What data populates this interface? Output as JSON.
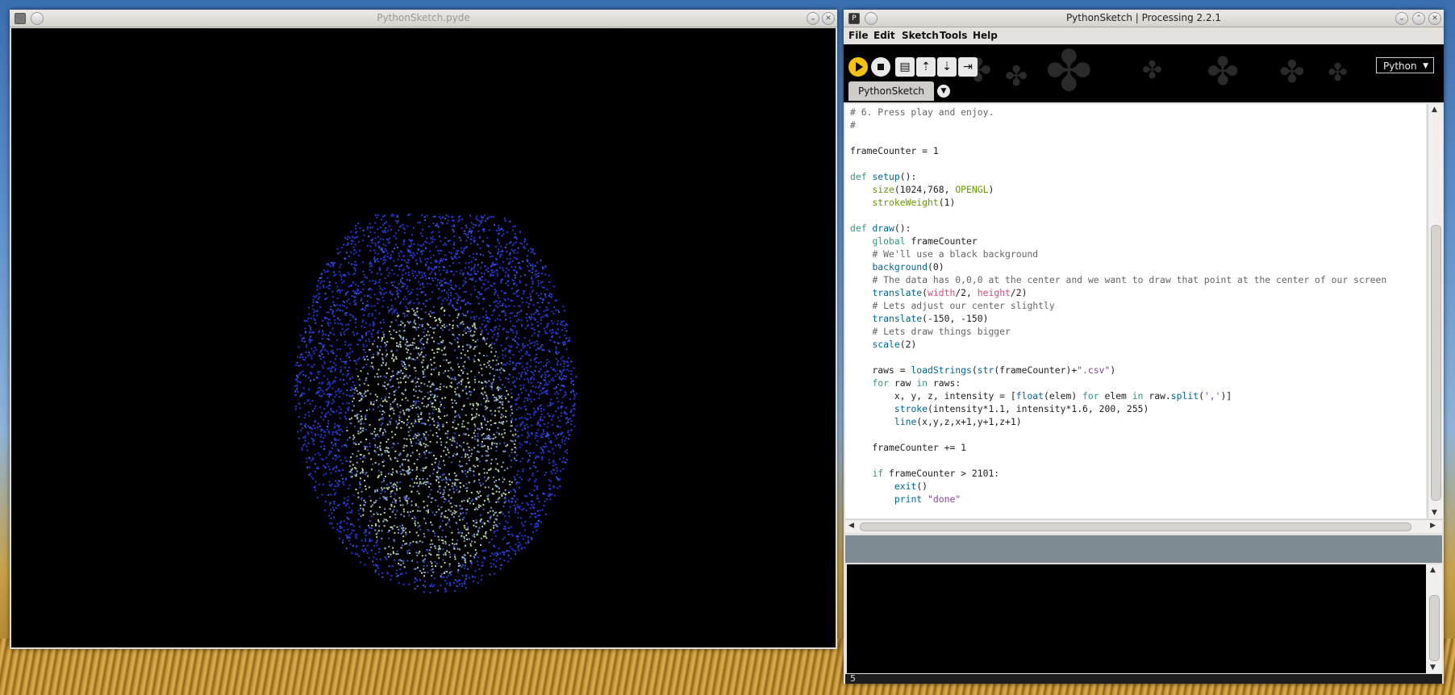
{
  "sketch_window": {
    "title": "PythonSketch.pyde"
  },
  "ide_window": {
    "title": "PythonSketch | Processing 2.2.1"
  },
  "menu": [
    "File",
    "Edit",
    "Sketch",
    "Tools",
    "Help"
  ],
  "toolbar": {
    "mode": "Python"
  },
  "tab": {
    "label": "PythonSketch"
  },
  "code": [
    [
      [
        "cm",
        "# 6. Press play and enjoy."
      ]
    ],
    [
      [
        "cm",
        "#"
      ]
    ],
    [],
    [
      [
        "t",
        "frameCounter = 1"
      ]
    ],
    [],
    [
      [
        "kw",
        "def "
      ],
      [
        "fn",
        "setup"
      ],
      [
        "t",
        "():"
      ]
    ],
    [
      [
        "t",
        "    "
      ],
      [
        "fn2",
        "size"
      ],
      [
        "t",
        "(1024,768, "
      ],
      [
        "fn2",
        "OPENGL"
      ],
      [
        "t",
        ")"
      ]
    ],
    [
      [
        "t",
        "    "
      ],
      [
        "fn2",
        "strokeWeight"
      ],
      [
        "t",
        "(1)"
      ]
    ],
    [],
    [
      [
        "kw",
        "def "
      ],
      [
        "fn",
        "draw"
      ],
      [
        "t",
        "():"
      ]
    ],
    [
      [
        "t",
        "    "
      ],
      [
        "kw",
        "global"
      ],
      [
        "t",
        " frameCounter"
      ]
    ],
    [
      [
        "t",
        "    "
      ],
      [
        "cm",
        "# We'll use a black background"
      ]
    ],
    [
      [
        "t",
        "    "
      ],
      [
        "fn",
        "background"
      ],
      [
        "t",
        "(0)"
      ]
    ],
    [
      [
        "t",
        "    "
      ],
      [
        "cm",
        "# The data has 0,0,0 at the center and we want to draw that point at the center of our screen"
      ]
    ],
    [
      [
        "t",
        "    "
      ],
      [
        "fn",
        "translate"
      ],
      [
        "t",
        "("
      ],
      [
        "var",
        "width"
      ],
      [
        "t",
        "/2, "
      ],
      [
        "var",
        "height"
      ],
      [
        "t",
        "/2)"
      ]
    ],
    [
      [
        "t",
        "    "
      ],
      [
        "cm",
        "# Lets adjust our center slightly"
      ]
    ],
    [
      [
        "t",
        "    "
      ],
      [
        "fn",
        "translate"
      ],
      [
        "t",
        "(-150, -150)"
      ]
    ],
    [
      [
        "t",
        "    "
      ],
      [
        "cm",
        "# Lets draw things bigger"
      ]
    ],
    [
      [
        "t",
        "    "
      ],
      [
        "fn",
        "scale"
      ],
      [
        "t",
        "(2)"
      ]
    ],
    [],
    [
      [
        "t",
        "    raws = "
      ],
      [
        "fn",
        "loadStrings"
      ],
      [
        "t",
        "("
      ],
      [
        "fn",
        "str"
      ],
      [
        "t",
        "(frameCounter)+"
      ],
      [
        "st",
        "\".csv\""
      ],
      [
        "t",
        ")"
      ]
    ],
    [
      [
        "t",
        "    "
      ],
      [
        "kw",
        "for"
      ],
      [
        "t",
        " raw "
      ],
      [
        "kw",
        "in"
      ],
      [
        "t",
        " raws:"
      ]
    ],
    [
      [
        "t",
        "        x, y, z, intensity = ["
      ],
      [
        "fn",
        "float"
      ],
      [
        "t",
        "(elem) "
      ],
      [
        "kw",
        "for"
      ],
      [
        "t",
        " elem "
      ],
      [
        "kw",
        "in"
      ],
      [
        "t",
        " raw."
      ],
      [
        "fn",
        "split"
      ],
      [
        "t",
        "("
      ],
      [
        "st",
        "','"
      ],
      [
        "t",
        ")]"
      ]
    ],
    [
      [
        "t",
        "        "
      ],
      [
        "fn",
        "stroke"
      ],
      [
        "t",
        "(intensity*1.1, intensity*1.6, 200, 255)"
      ]
    ],
    [
      [
        "t",
        "        "
      ],
      [
        "fn",
        "line"
      ],
      [
        "t",
        "(x,y,z,x+1,y+1,z+1)"
      ]
    ],
    [],
    [
      [
        "t",
        "    frameCounter += 1"
      ]
    ],
    [],
    [
      [
        "t",
        "    "
      ],
      [
        "kw",
        "if"
      ],
      [
        "t",
        " frameCounter > 2101:"
      ]
    ],
    [
      [
        "t",
        "        "
      ],
      [
        "fn",
        "exit"
      ],
      [
        "t",
        "()"
      ]
    ],
    [
      [
        "t",
        "        "
      ],
      [
        "fn",
        "print"
      ],
      [
        "t",
        " "
      ],
      [
        "st",
        "\"done\""
      ]
    ]
  ],
  "status": {
    "line_number": "5"
  },
  "colors": {
    "accent_run": "#f7c20e",
    "console_bg": "#000000",
    "status_bar": "#7f8b93"
  }
}
